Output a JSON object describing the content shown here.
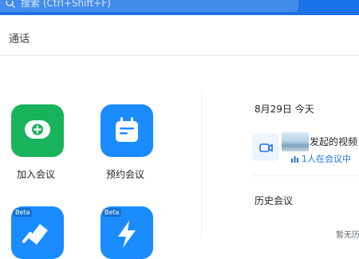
{
  "search": {
    "placeholder": "搜索 (Ctrl+Shift+F)",
    "icon": "search-icon"
  },
  "header": {
    "title": "通话"
  },
  "actions": [
    {
      "label": "加入会议",
      "color": "#19b35c",
      "icon": "join-meeting-icon"
    },
    {
      "label": "预约会议",
      "color": "#1a8cff",
      "icon": "calendar-icon"
    },
    {
      "badge": "Beta",
      "color": "#1a8cff",
      "icon": "screen-share-icon"
    },
    {
      "badge": "Beta",
      "color": "#1a8cff",
      "icon": "quick-meeting-icon"
    }
  ],
  "today": {
    "date_label": "8月29日 今天",
    "meeting": {
      "title": "发起的视频",
      "participants": "1人在会议中"
    }
  },
  "history": {
    "label": "历史会议",
    "empty": "暂无历"
  },
  "colors": {
    "brand": "#1a73e8",
    "green": "#19b35c",
    "blue": "#1a8cff"
  }
}
